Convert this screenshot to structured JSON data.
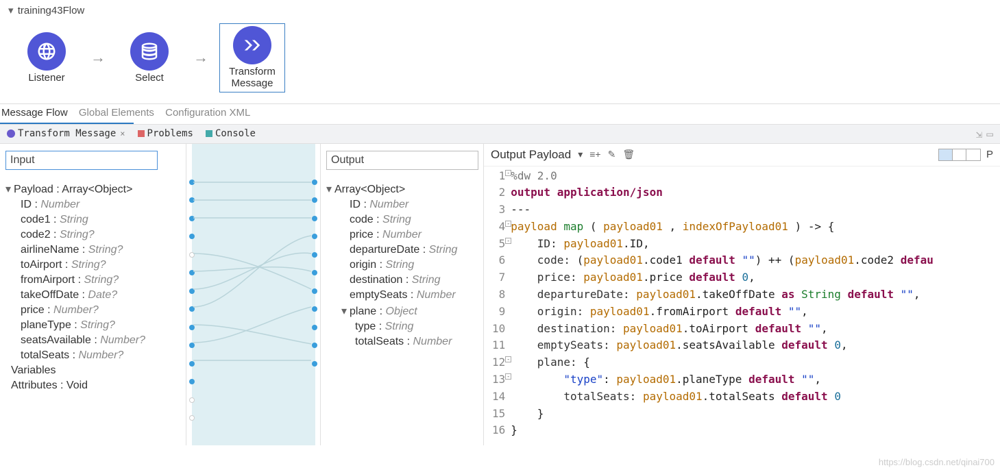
{
  "flow": {
    "title": "training43Flow",
    "nodes": [
      {
        "label": "Listener"
      },
      {
        "label": "Select"
      },
      {
        "label": "Transform\nMessage"
      }
    ]
  },
  "editorTabs": {
    "active": "Message Flow",
    "items": [
      "Message Flow",
      "Global Elements",
      "Configuration XML"
    ]
  },
  "panelTabs": {
    "items": [
      "Transform Message",
      "Problems",
      "Console"
    ]
  },
  "input": {
    "boxLabel": "Input",
    "root": "Payload : Array<Object>",
    "fields": [
      {
        "name": "ID",
        "type": "Number"
      },
      {
        "name": "code1",
        "type": "String"
      },
      {
        "name": "code2",
        "type": "String?"
      },
      {
        "name": "airlineName",
        "type": "String?"
      },
      {
        "name": "toAirport",
        "type": "String?"
      },
      {
        "name": "fromAirport",
        "type": "String?"
      },
      {
        "name": "takeOffDate",
        "type": "Date?"
      },
      {
        "name": "price",
        "type": "Number?"
      },
      {
        "name": "planeType",
        "type": "String?"
      },
      {
        "name": "seatsAvailable",
        "type": "Number?"
      },
      {
        "name": "totalSeats",
        "type": "Number?"
      }
    ],
    "variables": "Variables",
    "attributes": "Attributes : Void"
  },
  "output": {
    "boxLabel": "Output",
    "root": "Array<Object>",
    "fields": [
      {
        "name": "ID",
        "type": "Number"
      },
      {
        "name": "code",
        "type": "String"
      },
      {
        "name": "price",
        "type": "Number"
      },
      {
        "name": "departureDate",
        "type": "String"
      },
      {
        "name": "origin",
        "type": "String"
      },
      {
        "name": "destination",
        "type": "String"
      },
      {
        "name": "emptySeats",
        "type": "Number"
      }
    ],
    "planeLabel": "plane",
    "planeType": "Object",
    "planeFields": [
      {
        "name": "type",
        "type": "String"
      },
      {
        "name": "totalSeats",
        "type": "Number"
      }
    ]
  },
  "codeHeader": {
    "title": "Output Payload",
    "rightLabel": "P"
  },
  "code": {
    "lines": [
      {
        "n": "1",
        "html": "<span class='ann'>%dw 2.0</span>"
      },
      {
        "n": "2",
        "html": "<span class='kw'>output</span> <span class='kw'>application/json</span>"
      },
      {
        "n": "3",
        "html": "<span class='pun'>---</span>"
      },
      {
        "n": "4",
        "html": "<span class='id'>payload</span> <span class='fn'>map</span> <span class='pun'>(</span> <span class='id'>payload01</span> <span class='pun'>,</span> <span class='id'>indexOfPayload01</span> <span class='pun'>)</span> <span class='pun'>-&gt;</span> <span class='pun'>{</span>"
      },
      {
        "n": "5",
        "html": "    <span class='cls'>ID:</span> <span class='id'>payload01</span><span class='pun'>.ID,</span>"
      },
      {
        "n": "6",
        "html": "    <span class='cls'>code:</span> <span class='pun'>(</span><span class='id'>payload01</span><span class='pun'>.code1</span> <span class='kw2'>default</span> <span class='str'>\"\"</span><span class='pun'>)</span> <span class='pun'>++</span> <span class='pun'>(</span><span class='id'>payload01</span><span class='pun'>.code2</span> <span class='kw2'>defau</span>"
      },
      {
        "n": "7",
        "html": "    <span class='cls'>price:</span> <span class='id'>payload01</span><span class='pun'>.price</span> <span class='kw2'>default</span> <span class='num'>0</span><span class='pun'>,</span>"
      },
      {
        "n": "8",
        "html": "    <span class='cls'>departureDate:</span> <span class='id'>payload01</span><span class='pun'>.takeOffDate</span> <span class='kw2'>as</span> <span class='fn'>String</span> <span class='kw2'>default</span> <span class='str'>\"\"</span><span class='pun'>,</span>"
      },
      {
        "n": "9",
        "html": "    <span class='cls'>origin:</span> <span class='id'>payload01</span><span class='pun'>.fromAirport</span> <span class='kw2'>default</span> <span class='str'>\"\"</span><span class='pun'>,</span>"
      },
      {
        "n": "10",
        "html": "    <span class='cls'>destination:</span> <span class='id'>payload01</span><span class='pun'>.toAirport</span> <span class='kw2'>default</span> <span class='str'>\"\"</span><span class='pun'>,</span>"
      },
      {
        "n": "11",
        "html": "    <span class='cls'>emptySeats:</span> <span class='id'>payload01</span><span class='pun'>.seatsAvailable</span> <span class='kw2'>default</span> <span class='num'>0</span><span class='pun'>,</span>"
      },
      {
        "n": "12",
        "html": "    <span class='cls'>plane:</span> <span class='pun'>{</span>"
      },
      {
        "n": "13",
        "html": "        <span class='str'>\"type\"</span><span class='pun'>:</span> <span class='id'>payload01</span><span class='pun'>.planeType</span> <span class='kw2'>default</span> <span class='str'>\"\"</span><span class='pun'>,</span>"
      },
      {
        "n": "14",
        "html": "        <span class='cls'>totalSeats:</span> <span class='id'>payload01</span><span class='pun'>.totalSeats</span> <span class='kw2'>default</span> <span class='num'>0</span>"
      },
      {
        "n": "15",
        "html": "    <span class='pun'>}</span>"
      },
      {
        "n": "16",
        "html": "<span class='pun'>}</span>"
      }
    ]
  },
  "watermark": "https://blog.csdn.net/qinai700"
}
